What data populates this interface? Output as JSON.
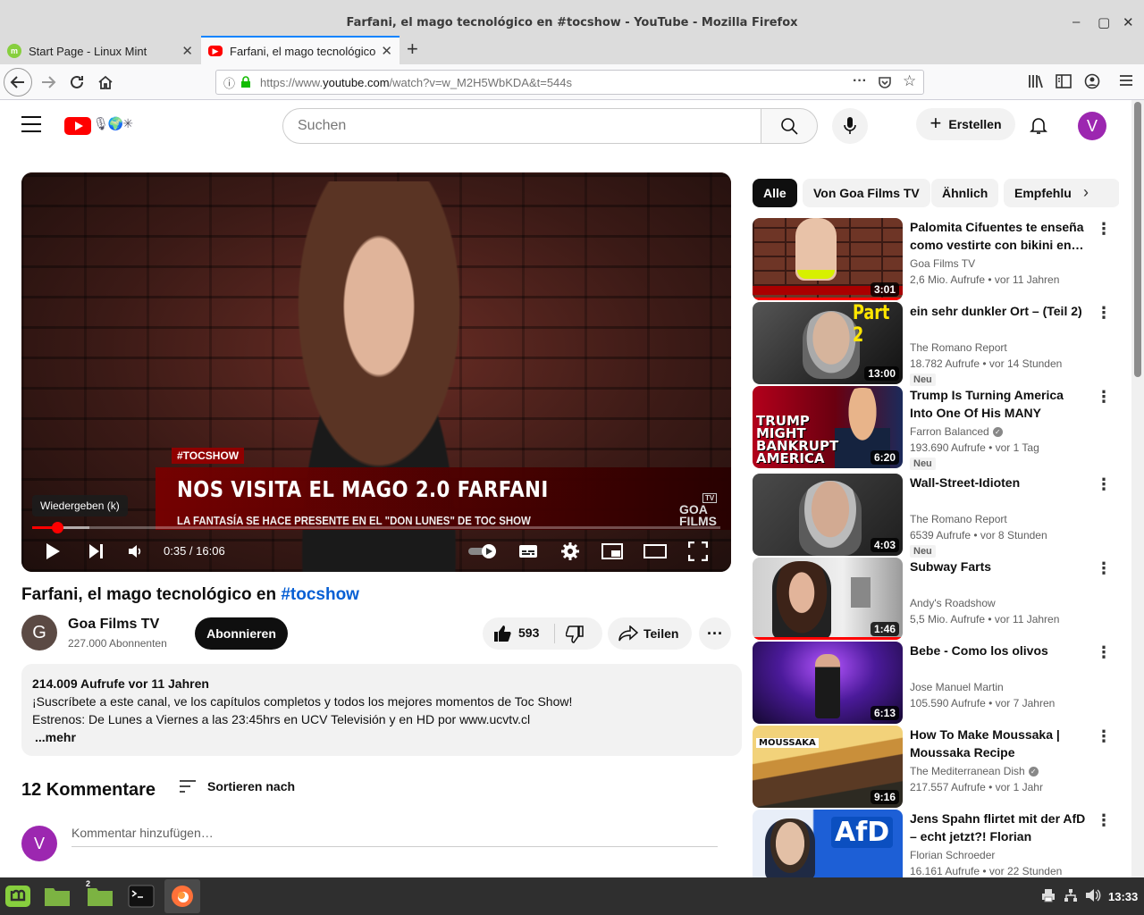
{
  "window": {
    "title": "Farfani, el mago tecnológico en #tocshow - YouTube - Mozilla Firefox"
  },
  "tabs": [
    {
      "label": "Start Page - Linux Mint",
      "favicon": "linux-mint-icon"
    },
    {
      "label": "Farfani, el mago tecnológico",
      "favicon": "youtube-icon"
    }
  ],
  "url": {
    "prefix": "https://www.",
    "host": "youtube.com",
    "path": "/watch?v=w_M2H5WbKDA&t=544s"
  },
  "youtube_header": {
    "search_placeholder": "Suchen",
    "create_label": "Erstellen",
    "avatar_letter": "V"
  },
  "player": {
    "badge": "#TOCSHOW",
    "headline": "NOS VISITA EL MAGO 2.0 FARFANI",
    "subline": "LA FANTASÍA SE HACE PRESENTE EN EL \"DON LUNES\" DE TOC SHOW",
    "brand": "GOA FILMS",
    "brand_tv": "TV",
    "tooltip": "Wiedergeben (k)",
    "time_text": "0:35 / 16:06",
    "progress_fraction": 0.036,
    "buffered_fraction": 0.083
  },
  "video": {
    "title_main": "Farfani, el mago tecnológico en ",
    "title_hashtag": "#tocshow",
    "channel_initial": "G",
    "channel_name": "Goa Films TV",
    "subscribers": "227.000 Abonnenten",
    "subscribe_label": "Abonnieren",
    "likes": "593",
    "share_label": "Teilen"
  },
  "description": {
    "stats": "214.009 Aufrufe  vor 11 Jahren",
    "line1": "¡Suscríbete a este canal, ve los capítulos completos y todos los mejores momentos de Toc Show!",
    "line2": "Estrenos: De Lunes a Viernes a las 23:45hrs en UCV Televisión y en HD por www.ucvtv.cl",
    "more": "...mehr"
  },
  "comments": {
    "header": "12 Kommentare",
    "sort_label": "Sortieren nach",
    "input_placeholder": "Kommentar hinzufügen…",
    "avatar_letter": "V"
  },
  "chips": [
    "Alle",
    "Von Goa Films TV",
    "Ähnlich",
    "Empfehlu"
  ],
  "recommendations": [
    {
      "title": "Palomita Cifuentes te enseña como vestirte con bikini en…",
      "channel": "Goa Films TV",
      "verified": false,
      "meta": "2,6 Mio. Aufrufe • vor 11 Jahren",
      "duration": "3:01",
      "badge": "",
      "watched": true
    },
    {
      "title": "ein sehr dunkler Ort – (Teil 2)",
      "channel": "The Romano Report",
      "verified": false,
      "meta": "18.782 Aufrufe • vor 14 Stunden",
      "duration": "13:00",
      "badge": "Neu",
      "watched": false,
      "thumb_text": "Part 2"
    },
    {
      "title": "Trump Is Turning America Into One Of His MANY Failed…",
      "channel": "Farron Balanced",
      "verified": true,
      "meta": "193.690 Aufrufe • vor 1 Tag",
      "duration": "6:20",
      "badge": "Neu",
      "watched": false,
      "thumb_text": "TRUMP MIGHT BANKRUPT AMERICA"
    },
    {
      "title": "Wall-Street-Idioten",
      "channel": "The Romano Report",
      "verified": false,
      "meta": "6539 Aufrufe • vor 8 Stunden",
      "duration": "4:03",
      "badge": "Neu",
      "watched": false
    },
    {
      "title": "Subway Farts",
      "channel": "Andy's Roadshow",
      "verified": false,
      "meta": "5,5 Mio. Aufrufe • vor 11 Jahren",
      "duration": "1:46",
      "badge": "",
      "watched": true
    },
    {
      "title": "Bebe - Como los olivos",
      "channel": "Jose Manuel Martin",
      "verified": false,
      "meta": "105.590 Aufrufe • vor 7 Jahren",
      "duration": "6:13",
      "badge": "",
      "watched": false
    },
    {
      "title": "How To Make Moussaka | Moussaka Recipe (Traditional…",
      "channel": "The Mediterranean Dish",
      "verified": true,
      "meta": "217.557 Aufrufe • vor 1 Jahr",
      "duration": "9:16",
      "badge": "",
      "watched": false,
      "thumb_text": "MOUSSAKA"
    },
    {
      "title": "Jens Spahn flirtet mit der AfD – echt jetzt?! Florian Schroeder",
      "channel": "Florian Schroeder",
      "verified": false,
      "meta": "16.161 Aufrufe • vor 22 Stunden",
      "duration": "",
      "badge": "",
      "watched": false,
      "thumb_text": "AfD"
    }
  ],
  "taskbar": {
    "workspace_badge": "2",
    "clock": "13:33"
  },
  "colors": {
    "yt_red": "#ff0000",
    "link_blue": "#065fd4",
    "avatar_purple": "#9c27b0",
    "firefox_blue": "#0a84ff"
  }
}
